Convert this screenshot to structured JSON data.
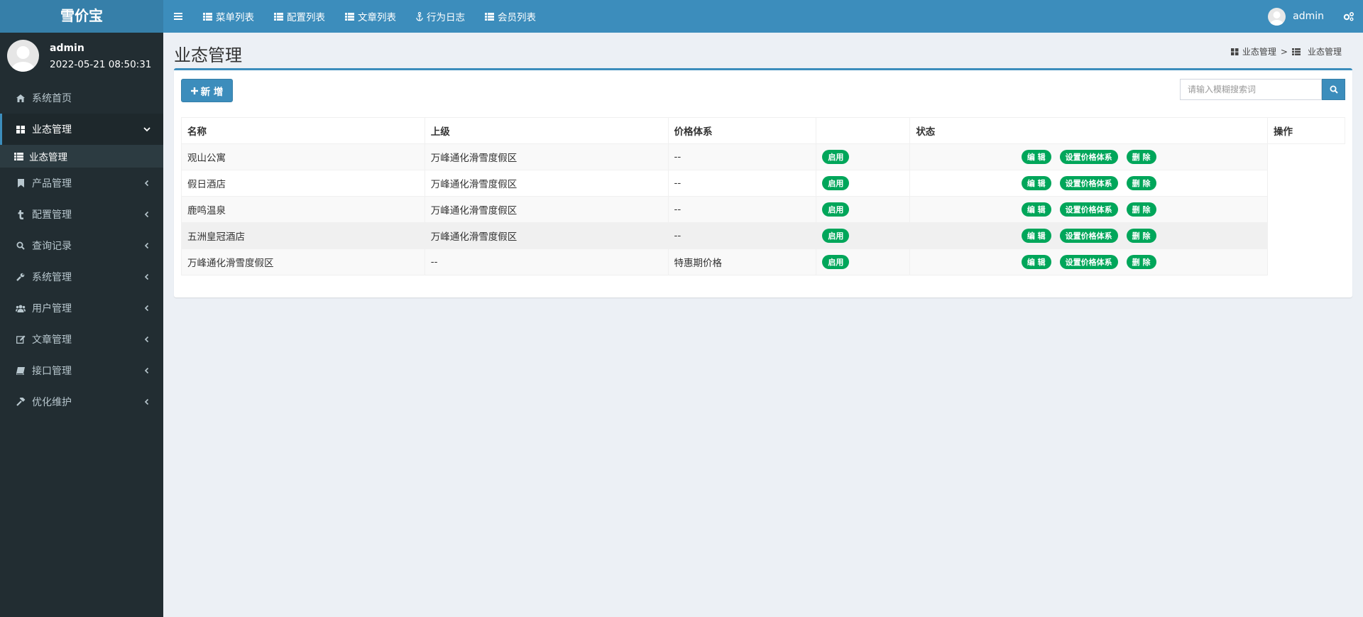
{
  "app": {
    "logo": "雪价宝"
  },
  "topnav": [
    {
      "label": "菜单列表",
      "icon": "list-icon"
    },
    {
      "label": "配置列表",
      "icon": "list-icon"
    },
    {
      "label": "文章列表",
      "icon": "list-icon"
    },
    {
      "label": "行为日志",
      "icon": "anchor-icon"
    },
    {
      "label": "会员列表",
      "icon": "list-icon"
    }
  ],
  "header_user": {
    "name": "admin"
  },
  "sidebar": {
    "user": {
      "name": "admin",
      "time": "2022-05-21 08:50:31"
    },
    "items": [
      {
        "label": "系统首页",
        "icon": "home-icon"
      },
      {
        "label": "业态管理",
        "icon": "dashboard-icon"
      },
      {
        "label": "产品管理",
        "icon": "bookmark-icon"
      },
      {
        "label": "配置管理",
        "icon": "tumblr-icon"
      },
      {
        "label": "查询记录",
        "icon": "search-icon"
      },
      {
        "label": "系统管理",
        "icon": "wrench-icon"
      },
      {
        "label": "用户管理",
        "icon": "users-icon"
      },
      {
        "label": "文章管理",
        "icon": "edit-icon"
      },
      {
        "label": "接口管理",
        "icon": "book-icon"
      },
      {
        "label": "优化维护",
        "icon": "gavel-icon"
      }
    ],
    "submenu": {
      "label": "业态管理",
      "icon": "list-icon"
    }
  },
  "page": {
    "title": "业态管理",
    "breadcrumb": [
      "业态管理",
      "业态管理"
    ],
    "breadcrumb_sep": ">"
  },
  "toolbar": {
    "add_label": "新 增",
    "search_placeholder": "请输入模糊搜索词"
  },
  "table": {
    "headers": [
      "名称",
      "上级",
      "价格体系",
      "",
      "状态",
      "操作"
    ],
    "rows": [
      {
        "name": "观山公寓",
        "parent": "万峰通化滑雪度假区",
        "price": "--",
        "status": "启用"
      },
      {
        "name": "假日酒店",
        "parent": "万峰通化滑雪度假区",
        "price": "--",
        "status": "启用"
      },
      {
        "name": "鹿鸣温泉",
        "parent": "万峰通化滑雪度假区",
        "price": "--",
        "status": "启用"
      },
      {
        "name": "五洲皇冠酒店",
        "parent": "万峰通化滑雪度假区",
        "price": "--",
        "status": "启用"
      },
      {
        "name": "万峰通化滑雪度假区",
        "parent": "--",
        "price": "特惠期价格",
        "status": "启用"
      }
    ],
    "actions": [
      "编 辑",
      "设置价格体系",
      "删 除"
    ]
  },
  "colors": {
    "primary": "#3c8dbc",
    "sidebar": "#222d32",
    "success": "#00a65a"
  }
}
